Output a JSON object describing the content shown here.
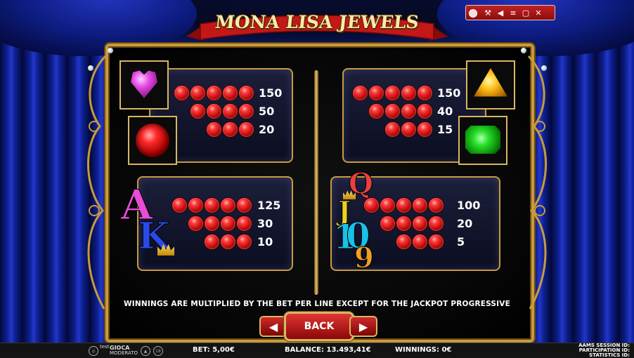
{
  "game": {
    "title": "MONA LISA JEWELS"
  },
  "colors": {
    "accent_gold": "#c99a3c",
    "button_red": "#c32222",
    "gem_red": "#ff3b3b",
    "curtain_blue": "#0c1f8e"
  },
  "window_controls": [
    {
      "icon": "wrench-icon",
      "glyph": "⚒"
    },
    {
      "icon": "sound-icon",
      "glyph": "◀"
    },
    {
      "icon": "bars-icon",
      "glyph": "≡"
    },
    {
      "icon": "fullscreen-icon",
      "glyph": "▢"
    },
    {
      "icon": "close-icon",
      "glyph": "✕"
    }
  ],
  "paytable": [
    {
      "id": "heart-ruby",
      "symbols": [
        "pink-heart-gem",
        "red-round-gem"
      ],
      "payouts": [
        {
          "count": 5,
          "value": "150"
        },
        {
          "count": 4,
          "value": "50"
        },
        {
          "count": 3,
          "value": "20"
        }
      ]
    },
    {
      "id": "topaz-emerald",
      "symbols": [
        "yellow-trillion-gem",
        "green-emerald-gem"
      ],
      "payouts": [
        {
          "count": 5,
          "value": "150"
        },
        {
          "count": 4,
          "value": "40"
        },
        {
          "count": 3,
          "value": "15"
        }
      ]
    },
    {
      "id": "ace-king",
      "symbols": [
        "A",
        "K"
      ],
      "payouts": [
        {
          "count": 5,
          "value": "125"
        },
        {
          "count": 4,
          "value": "30"
        },
        {
          "count": 3,
          "value": "10"
        }
      ]
    },
    {
      "id": "queen-jack-ten",
      "symbols": [
        "Q",
        "J",
        "10"
      ],
      "payouts": [
        {
          "count": 5,
          "value": "100"
        },
        {
          "count": 4,
          "value": "20"
        },
        {
          "count": 3,
          "value": "5"
        }
      ]
    }
  ],
  "letters": {
    "A": "A",
    "K": "K",
    "Q": "Q",
    "J": "J",
    "T1": "1",
    "T0": "0",
    "N9": "9"
  },
  "note": "WINNINGS ARE MULTIPLIED BY THE BET PER LINE EXCEPT FOR THE JACKPOT PROGRESSIVE",
  "nav": {
    "back_label": "BACK",
    "prev_glyph": "◀",
    "next_glyph": "▶"
  },
  "status": {
    "bet": "BET: 5,00€",
    "balance": "BALANCE: 13.493,41€",
    "winnings": "WINNINGS: 0€",
    "session_label": "AAMS SESSION ID:",
    "participation_label": "PARTICIPATION ID:",
    "statistics_label": "STATISTICS ID:",
    "logo_test": "test",
    "logo_gioca": "GIOCA",
    "logo_moderato": "MODERATO",
    "age_badge": "18"
  }
}
